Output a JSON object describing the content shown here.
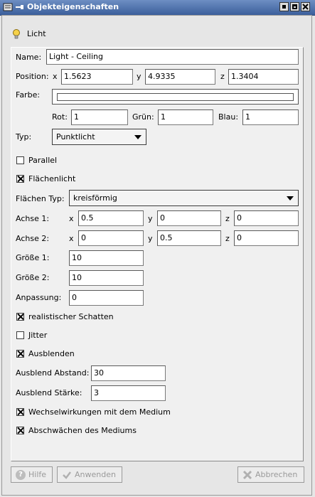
{
  "window": {
    "title": "Objekteigenschaften"
  },
  "header": {
    "object_label": "Licht",
    "object_icon": "lightbulb-icon"
  },
  "form": {
    "name_label": "Name:",
    "name_value": "Light - Ceiling",
    "position_label": "Position:",
    "x_label": "x",
    "y_label": "y",
    "z_label": "z",
    "position_x": "1.5623",
    "position_y": "4.9335",
    "position_z": "1.3404",
    "farbe_label": "Farbe:",
    "farbe_color": "#ffffff",
    "rot_label": "Rot:",
    "rot_value": "1",
    "gruen_label": "Grün:",
    "gruen_value": "1",
    "blau_label": "Blau:",
    "blau_value": "1",
    "typ_label": "Typ:",
    "typ_value": "Punktlicht",
    "parallel_label": "Parallel",
    "parallel_checked": false,
    "flaechenlicht_label": "Flächenlicht",
    "flaechenlicht_checked": true,
    "flaechen_typ_label": "Flächen Typ:",
    "flaechen_typ_value": "kreisförmig",
    "achse1_label": "Achse 1:",
    "achse1_x": "0.5",
    "achse1_y": "0",
    "achse1_z": "0",
    "achse2_label": "Achse 2:",
    "achse2_x": "0",
    "achse2_y": "0.5",
    "achse2_z": "0",
    "groesse1_label": "Größe 1:",
    "groesse1_value": "10",
    "groesse2_label": "Größe 2:",
    "groesse2_value": "10",
    "anpassung_label": "Anpassung:",
    "anpassung_value": "0",
    "realistischer_schatten_label": "realistischer Schatten",
    "realistischer_schatten_checked": true,
    "jitter_label": "Jitter",
    "jitter_checked": false,
    "ausblenden_label": "Ausblenden",
    "ausblenden_checked": true,
    "ausblend_abstand_label": "Ausblend Abstand:",
    "ausblend_abstand_value": "30",
    "ausblend_staerke_label": "Ausblend Stärke:",
    "ausblend_staerke_value": "3",
    "wechselwirkungen_label": "Wechselwirkungen mit dem Medium",
    "wechselwirkungen_checked": true,
    "abschwaechen_label": "Abschwächen des Mediums",
    "abschwaechen_checked": true
  },
  "buttons": {
    "hilfe": "Hilfe",
    "anwenden": "Anwenden",
    "abbrechen": "Abbrechen"
  }
}
